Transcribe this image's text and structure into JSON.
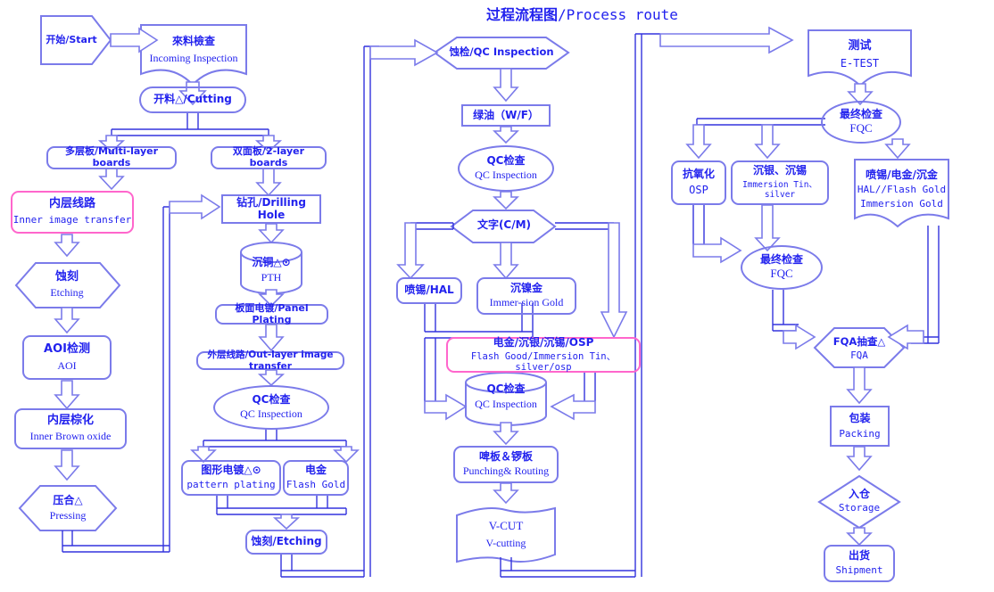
{
  "page": {
    "title_cn": "过程流程图",
    "title_sep": "/",
    "title_en": "Process route",
    "colors": {
      "line": "#7b7bea",
      "text": "#2222ee",
      "highlight": "#ff66cc",
      "background": "#ffffff"
    }
  },
  "nodes": {
    "start": {
      "cn": "开始/Start",
      "en": "",
      "shape": "pentagon"
    },
    "incoming": {
      "cn": "來料檢查",
      "en": "Incoming Inspection",
      "shape": "document"
    },
    "cutting": {
      "cn": "开料△/Cutting",
      "en": "",
      "shape": "stadium"
    },
    "multilayer": {
      "cn": "多层板/Multi-layer boards",
      "en": "",
      "shape": "rrect"
    },
    "twolayer": {
      "cn": "双面板/2-layer boards",
      "en": "",
      "shape": "rrect"
    },
    "inner_image": {
      "cn": "内层线路",
      "en": "Inner image transfer",
      "shape": "rrect-pink"
    },
    "etching_inner": {
      "cn": "蚀刻",
      "en": "Etching",
      "shape": "hexagon"
    },
    "aoi": {
      "cn": "AOI检测",
      "en": "AOI",
      "shape": "rrect"
    },
    "brown_oxide": {
      "cn": "内层棕化",
      "en": "Inner Brown oxide",
      "shape": "rrect"
    },
    "pressing": {
      "cn": "压合△",
      "en": "Pressing",
      "shape": "hexagon"
    },
    "drilling": {
      "cn": "钻孔/Drilling Hole",
      "en": "",
      "shape": "rect"
    },
    "pth": {
      "cn": "沉铜△⊙",
      "en": "PTH",
      "shape": "cylinder"
    },
    "panel_plating": {
      "cn": "板面电镀/Panel Plating",
      "en": "",
      "shape": "rrect"
    },
    "outer_image": {
      "cn": "外层线路/Out-layer image transfer",
      "en": "",
      "shape": "rrect"
    },
    "qc_outer": {
      "cn": "QC检查",
      "en": "QC Inspection",
      "shape": "ellipse"
    },
    "pattern_plating": {
      "cn": "图形电镀△⊙",
      "en": "pattern plating",
      "shape": "rrect"
    },
    "flash_gold": {
      "cn": "电金",
      "en": "Flash Gold",
      "shape": "rrect"
    },
    "etching_outer": {
      "cn": "蚀刻/Etching",
      "en": "",
      "shape": "rrect"
    },
    "qc_insp_hex": {
      "cn": "蚀检/QC Inspection",
      "en": "",
      "shape": "hexagon"
    },
    "green_oil": {
      "cn": "绿油（W/F）",
      "en": "",
      "shape": "rect"
    },
    "qc_wf": {
      "cn": "QC检查",
      "en": "QC Inspection",
      "shape": "ellipse"
    },
    "legend_cm": {
      "cn": "文字(C/M)",
      "en": "",
      "shape": "hexagon"
    },
    "hal": {
      "cn": "喷锡/HAL",
      "en": "",
      "shape": "rrect"
    },
    "immersion_gold": {
      "cn": "沉镍金",
      "en": "Immer-sion Gold",
      "shape": "rrect"
    },
    "surface_finish": {
      "cn": "电金/沉银/沉锡/OSP",
      "en": "Flash Good/Immersion Tin、silver/osp",
      "shape": "rrect-pink"
    },
    "qc_final_cyl": {
      "cn": "QC检查",
      "en": "QC Inspection",
      "shape": "cylinder"
    },
    "punch_rout": {
      "cn": "啤板＆锣板",
      "en": "Punching& Routing",
      "shape": "rrect"
    },
    "vcut": {
      "cn": "V-CUT",
      "en": "V-cutting",
      "shape": "wave"
    },
    "etest": {
      "cn": "测试",
      "en": "E-TEST",
      "shape": "document"
    },
    "fqc_top": {
      "cn": "最终检查",
      "en": "FQC",
      "shape": "ellipse"
    },
    "osp": {
      "cn": "抗氧化",
      "en": "OSP",
      "shape": "rrect"
    },
    "imm_tin_silver": {
      "cn": "沉银、沉锡",
      "en": "Immersion Tin、silver",
      "shape": "rrect"
    },
    "hal_gold": {
      "cn": "喷锡/电金/沉金",
      "en": "HAL//Flash Gold",
      "en2": "Immersion Gold",
      "shape": "document"
    },
    "fqc_mid": {
      "cn": "最终检查",
      "en": "FQC",
      "shape": "ellipse"
    },
    "fqa": {
      "cn": "FQA抽查△",
      "en": "FQA",
      "shape": "hexagon"
    },
    "packing": {
      "cn": "包装",
      "en": "Packing",
      "shape": "rect"
    },
    "storage": {
      "cn": "入仓",
      "en": "Storage",
      "shape": "diamond"
    },
    "shipment": {
      "cn": "出货",
      "en": "Shipment",
      "shape": "rrect"
    }
  }
}
